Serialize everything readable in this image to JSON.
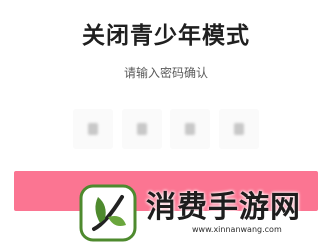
{
  "dialog": {
    "title": "关闭青少年模式",
    "subtitle": "请输入密码确认"
  },
  "code_boxes": [
    {
      "state": "filled-masked"
    },
    {
      "state": "filled-masked"
    },
    {
      "state": "filled-masked"
    },
    {
      "state": "filled-masked"
    }
  ],
  "confirm_button": {
    "label": "",
    "color": "#fb7592"
  },
  "watermark": {
    "title": "消费手游网",
    "url": "www.xinnanwang.com",
    "logo_icon": "leaf-logo-icon",
    "logo_color": "#4e8a2e"
  }
}
